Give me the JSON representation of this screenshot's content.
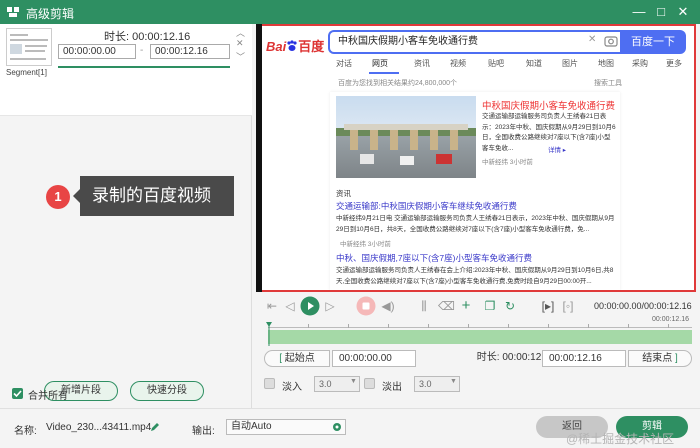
{
  "window": {
    "title": "高级剪辑",
    "minimize": "—",
    "maximize": "□",
    "close": "✕"
  },
  "segments": {
    "label": "Segment[1]",
    "duration": "时长: 00:00:12.16",
    "start_time": "00:00:00.00",
    "end_time": "00:00:12.16"
  },
  "tooltip": {
    "number": "1",
    "text": "录制的百度视频"
  },
  "left_buttons": {
    "new_segment": "新增片段",
    "quick_split": "快速分段"
  },
  "merge_all": {
    "label": "合并所有",
    "checked": true
  },
  "browser": {
    "logo_text": "Bai",
    "logo_cn": "百度",
    "query": "中秋国庆假期小客车免收通行费",
    "search_button": "百度一下",
    "tabs": [
      "对话",
      "网页",
      "资讯",
      "视频",
      "贴吧",
      "知道",
      "图片",
      "地图",
      "采购",
      "更多"
    ],
    "result_info": "百度为您找到相关结果约24,800,000个",
    "search_tools": "搜索工具",
    "card_title": "中秋国庆假期小客车免收通行费",
    "card_snippet": "交通运输部运输服务司负责人王绣春21日表示：2023年中秋、国庆假期从9月29日到10月6日，全国收费公路继续对7座以下(含7座)小型客车免收...",
    "card_more": "详情 ▸",
    "card_source": "中新经纬  3小时前",
    "section_label": "资讯",
    "result1_title": "交通运输部:中秋国庆假期小客车继续免收通行费",
    "result1_snippet": "中新经纬9月21日电 交通运输部运输服务司负责人王绣春21日表示，2023年中秋、国庆假期从9月29日到10月6日，共8天，全国收费公路继续对7座以下(含7座)小型客车免收通行费，免...",
    "result1_source": "中新经纬  3小时前",
    "result2_title": "中秋、国庆假期,7座以下(含7座)小型客车免收通行费",
    "result2_snippet": "交通运输部运输服务司负责人王绣春在会上介绍:2023年中秋、国庆假期从9月29日到10月6日,共8天,全国收费公路继续对7座以下(含7座)小型客车免收通行费,免费时段自9月29日00:00开..."
  },
  "controls": {
    "time_display": "00:00:00.00/00:00:12.16",
    "timeline_time": "00:00:12.16"
  },
  "trim": {
    "start_btn": "起始点",
    "start_time": "00:00:00.00",
    "duration": "时长:  00:00:12.16",
    "end_time": "00:00:12.16",
    "end_btn": "结束点"
  },
  "fade": {
    "fade_in": "淡入",
    "fade_in_value": "3.0",
    "fade_out": "淡出",
    "fade_out_value": "3.0"
  },
  "footer": {
    "name_label": "名称:",
    "name_value": "Video_230...43411.mp4",
    "output_label": "输出:",
    "output_value": "自动Auto",
    "back": "返回",
    "clip": "剪辑",
    "watermark": "@稀土掘金技术社区"
  },
  "colors": {
    "accent": "#2e8f62",
    "highlight_border": "#e03a3a",
    "baidu_blue": "#4e6ef2",
    "result_red": "#ee3333"
  }
}
